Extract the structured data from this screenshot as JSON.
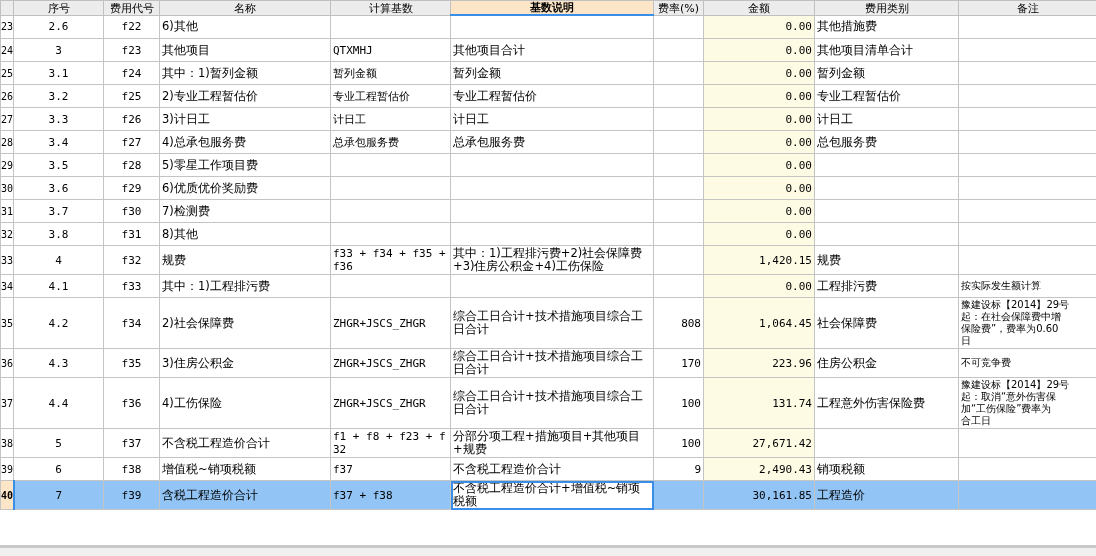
{
  "columns": [
    {
      "label": "序号",
      "selected": false
    },
    {
      "label": "费用代号",
      "selected": false
    },
    {
      "label": "名称",
      "selected": false
    },
    {
      "label": "计算基数",
      "selected": false
    },
    {
      "label": "基数说明",
      "selected": true
    },
    {
      "label": "费率(%)",
      "selected": false
    },
    {
      "label": "金额",
      "selected": false
    },
    {
      "label": "费用类别",
      "selected": false
    },
    {
      "label": "备注",
      "selected": false
    }
  ],
  "rows": [
    {
      "row": "23",
      "no": "2.6",
      "code": "f22",
      "name": "6)其他",
      "amount": "0.00",
      "category": "其他措施费",
      "selected": false,
      "editing": false
    },
    {
      "row": "24",
      "no": "3",
      "code": "f23",
      "name": "其他项目",
      "base": "QTXMHJ",
      "base_desc": "其他项目合计",
      "amount": "0.00",
      "category": "其他项目清单合计",
      "selected": false,
      "editing": false
    },
    {
      "row": "25",
      "no": "3.1",
      "code": "f24",
      "name": "其中：1)暂列金额",
      "base": "暂列金额",
      "base_desc": "暂列金额",
      "amount": "0.00",
      "category": "暂列金额",
      "selected": false,
      "editing": false
    },
    {
      "row": "26",
      "no": "3.2",
      "code": "f25",
      "name": "2)专业工程暂估价",
      "base": "专业工程暂估价",
      "base_desc": "专业工程暂估价",
      "amount": "0.00",
      "category": "专业工程暂估价",
      "selected": false,
      "editing": false
    },
    {
      "row": "27",
      "no": "3.3",
      "code": "f26",
      "name": "3)计日工",
      "base": "计日工",
      "base_desc": "计日工",
      "amount": "0.00",
      "category": "计日工",
      "selected": false,
      "editing": false
    },
    {
      "row": "28",
      "no": "3.4",
      "code": "f27",
      "name": "4)总承包服务费",
      "base": "总承包服务费",
      "base_desc": "总承包服务费",
      "amount": "0.00",
      "category": "总包服务费",
      "selected": false,
      "editing": false
    },
    {
      "row": "29",
      "no": "3.5",
      "code": "f28",
      "name": "5)零星工作项目费",
      "amount": "0.00",
      "selected": false,
      "editing": false
    },
    {
      "row": "30",
      "no": "3.6",
      "code": "f29",
      "name": "6)优质优价奖励费",
      "amount": "0.00",
      "selected": false,
      "editing": false
    },
    {
      "row": "31",
      "no": "3.7",
      "code": "f30",
      "name": "7)检测费",
      "amount": "0.00",
      "selected": false,
      "editing": false
    },
    {
      "row": "32",
      "no": "3.8",
      "code": "f31",
      "name": "8)其他",
      "amount": "0.00",
      "selected": false,
      "editing": false
    },
    {
      "row": "33",
      "no": "4",
      "code": "f32",
      "name": "规费",
      "base": "f33 + f34 + f35 + f36",
      "base_desc": "其中：1)工程排污费+2)社会保障费+3)住房公积金+4)工伤保险",
      "amount": "1,420.15",
      "category": "规费",
      "selected": false,
      "editing": false
    },
    {
      "row": "34",
      "no": "4.1",
      "code": "f33",
      "name": "其中：1)工程排污费",
      "amount": "0.00",
      "category": "工程排污费",
      "note": [
        "按实际发生额计算"
      ],
      "selected": false,
      "editing": false
    },
    {
      "row": "35",
      "no": "4.2",
      "code": "f34",
      "name": "2)社会保障费",
      "base": "ZHGR+JSCS_ZHGR",
      "base_desc": "综合工日合计+技术措施项目综合工日合计",
      "rate": "808",
      "amount": "1,064.45",
      "category": "社会保障费",
      "note": [
        "豫建设标【2014】29号",
        "起：在社会保障费中增",
        "保险费”，费率为0.60",
        "日"
      ],
      "selected": false,
      "editing": false
    },
    {
      "row": "36",
      "no": "4.3",
      "code": "f35",
      "name": "3)住房公积金",
      "base": "ZHGR+JSCS_ZHGR",
      "base_desc": "综合工日合计+技术措施项目综合工日合计",
      "rate": "170",
      "amount": "223.96",
      "category": "住房公积金",
      "note": [
        "不可竞争费"
      ],
      "selected": false,
      "editing": false
    },
    {
      "row": "37",
      "no": "4.4",
      "code": "f36",
      "name": "4)工伤保险",
      "base": "ZHGR+JSCS_ZHGR",
      "base_desc": "综合工日合计+技术措施项目综合工日合计",
      "rate": "100",
      "amount": "131.74",
      "category": "工程意外伤害保险费",
      "note": [
        "豫建设标【2014】29号",
        "起：取消“意外伤害保",
        "加“工伤保险”费率为",
        "合工日"
      ],
      "selected": false,
      "editing": false
    },
    {
      "row": "38",
      "no": "5",
      "code": "f37",
      "name": "不含税工程造价合计",
      "base": "f1 + f8 + f23 + f32",
      "base_desc": "分部分项工程+措施项目+其他项目+规费",
      "rate": "100",
      "amount": "27,671.42",
      "selected": false,
      "editing": false
    },
    {
      "row": "39",
      "no": "6",
      "code": "f38",
      "name": "增值税~销项税额",
      "base": "f37",
      "base_desc": "不含税工程造价合计",
      "rate": "9",
      "amount": "2,490.43",
      "category": "销项税额",
      "selected": false,
      "editing": false
    },
    {
      "row": "40",
      "no": "7",
      "code": "f39",
      "name": "含税工程造价合计",
      "base": "f37 + f38",
      "base_desc": "不含税工程造价合计+增值税~销项税额",
      "amount": "30,161.85",
      "category": "工程造价",
      "selected": true,
      "editing": true
    }
  ]
}
